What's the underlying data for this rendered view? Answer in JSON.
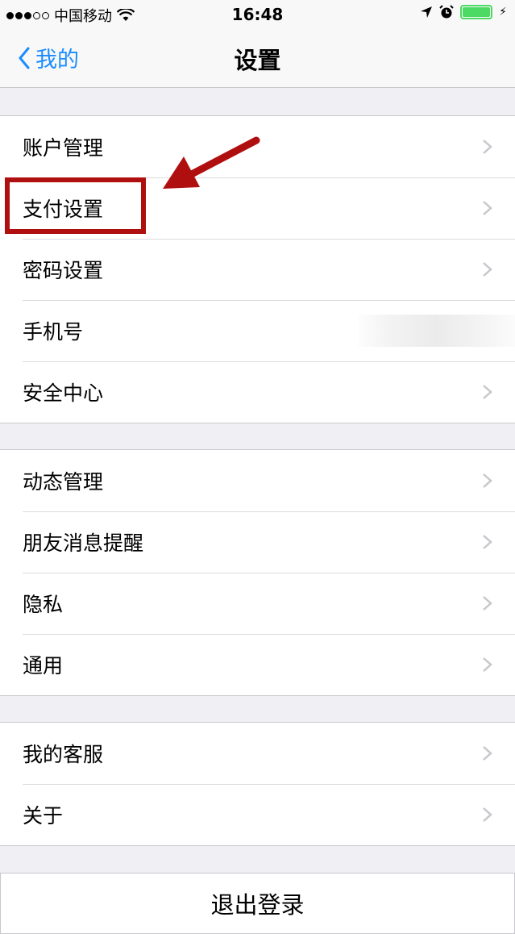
{
  "status_bar": {
    "carrier": "中国移动",
    "time": "16:48",
    "signal_bars_filled": 3,
    "signal_bars_total": 5,
    "battery_level": 1.0,
    "icons": [
      "wifi-icon",
      "location-arrow-icon",
      "alarm-icon",
      "battery-icon",
      "charging-bolt-icon"
    ]
  },
  "nav": {
    "back_label": "我的",
    "title": "设置"
  },
  "groups": [
    {
      "items": [
        {
          "label": "账户管理",
          "chevron": true
        },
        {
          "label": "支付设置",
          "chevron": true
        },
        {
          "label": "密码设置",
          "chevron": true
        },
        {
          "label": "手机号",
          "chevron": false
        },
        {
          "label": "安全中心",
          "chevron": true
        }
      ]
    },
    {
      "items": [
        {
          "label": "动态管理",
          "chevron": true
        },
        {
          "label": "朋友消息提醒",
          "chevron": true
        },
        {
          "label": "隐私",
          "chevron": true
        },
        {
          "label": "通用",
          "chevron": true
        }
      ]
    },
    {
      "items": [
        {
          "label": "我的客服",
          "chevron": true
        },
        {
          "label": "关于",
          "chevron": true
        }
      ]
    }
  ],
  "logout_label": "退出登录",
  "colors": {
    "accent": "#1a8cff",
    "background": "#efeff4",
    "highlight": "#b00f0f",
    "battery": "#4cd964"
  }
}
